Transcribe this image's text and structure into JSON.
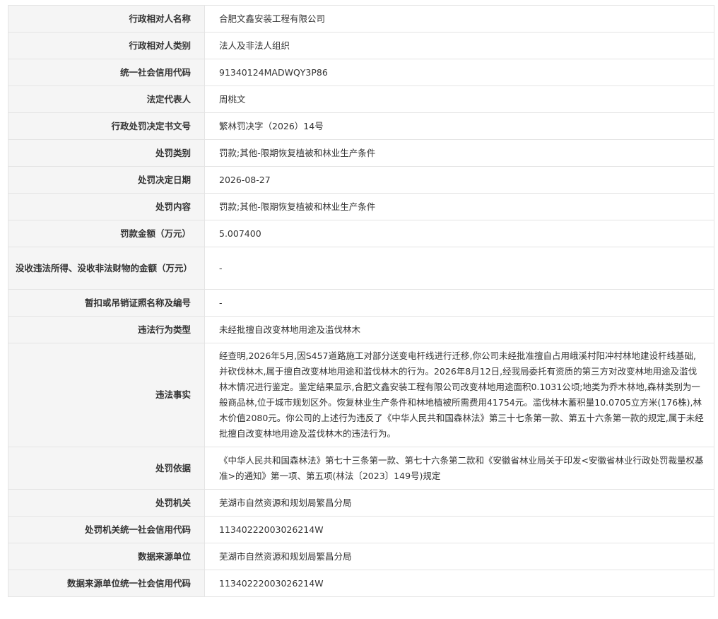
{
  "rows": [
    {
      "label": "行政相对人名称",
      "value": "合肥文鑫安装工程有限公司"
    },
    {
      "label": "行政相对人类别",
      "value": "法人及非法人组织"
    },
    {
      "label": "统一社会信用代码",
      "value": "91340124MADWQY3P86"
    },
    {
      "label": "法定代表人",
      "value": "周桃文"
    },
    {
      "label": "行政处罚决定书文号",
      "value": "繁林罚决字（2026）14号"
    },
    {
      "label": "处罚类别",
      "value": "罚款;其他-限期恢复植被和林业生产条件"
    },
    {
      "label": "处罚决定日期",
      "value": "2026-08-27"
    },
    {
      "label": "处罚内容",
      "value": "罚款;其他-限期恢复植被和林业生产条件"
    },
    {
      "label": "罚款金额（万元）",
      "value": "5.007400"
    },
    {
      "label": "没收违法所得、没收非法财物的金额（万元）",
      "value": "-"
    },
    {
      "label": "暂扣或吊销证照名称及编号",
      "value": "-"
    },
    {
      "label": "违法行为类型",
      "value": "未经批擅自改变林地用途及滥伐林木"
    },
    {
      "label": "违法事实",
      "value": "经查明,2026年5月,因S457道路施工对部分送变电杆线进行迁移,你公司未经批准擅自占用峨溪村阳冲村林地建设杆线基础,并砍伐林木,属于擅自改变林地用途和滥伐林木的行为。2026年8月12日,经我局委托有资质的第三方对改变林地用途及滥伐林木情况进行鉴定。鉴定结果显示,合肥文鑫安装工程有限公司改变林地用途面积0.1031公顷;地类为乔木林地,森林类别为一般商品林,位于城市规划区外。恢复林业生产条件和林地植被所需费用41754元。滥伐林木蓄积量10.0705立方米(176株),林木价值2080元。你公司的上述行为违反了《中华人民共和国森林法》第三十七条第一款、第五十六条第一款的规定,属于未经批擅自改变林地用途及滥伐林木的违法行为。"
    },
    {
      "label": "处罚依据",
      "value": "《中华人民共和国森林法》第七十三条第一款、第七十六条第二款和《安徽省林业局关于印发<安徽省林业行政处罚裁量权基准>的通知》第一项、第五项(林法〔2023〕149号)规定"
    },
    {
      "label": "处罚机关",
      "value": "芜湖市自然资源和规划局繁昌分局"
    },
    {
      "label": "处罚机关统一社会信用代码",
      "value": "11340222003026214W"
    },
    {
      "label": "数据来源单位",
      "value": "芜湖市自然资源和规划局繁昌分局"
    },
    {
      "label": "数据来源单位统一社会信用代码",
      "value": "11340222003026214W"
    }
  ]
}
